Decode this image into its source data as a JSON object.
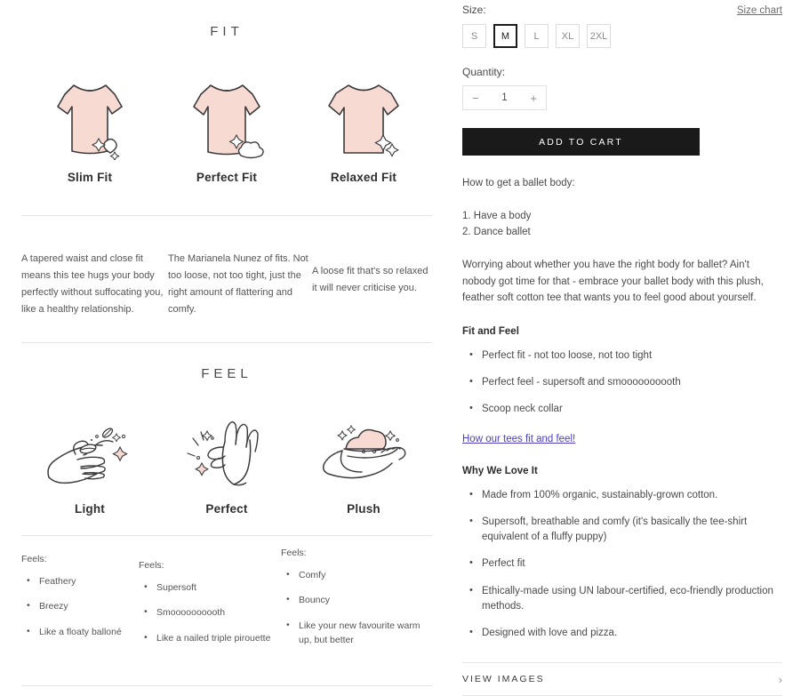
{
  "left": {
    "fit": {
      "heading": "FIT",
      "items": [
        {
          "label": "Slim Fit",
          "icon": "tshirt-slim-icon",
          "description": "A tapered waist and close fit means this tee hugs your body perfectly without suffocating you, like a healthy\nrelationship."
        },
        {
          "label": "Perfect Fit",
          "icon": "tshirt-perfect-icon",
          "description": "The Marianela Nunez of fits.\nNot too loose, not too tight, just the right amount of flattering and comfy."
        },
        {
          "label": "Relaxed Fit",
          "icon": "tshirt-relaxed-icon",
          "description": "A loose fit that's so relaxed it will never criticise you."
        }
      ]
    },
    "feel": {
      "heading": "FEEL",
      "items": [
        {
          "label": "Light",
          "icon": "hand-feather-icon",
          "feels_title": "Feels:",
          "feels": [
            "Feathery",
            "Breezy",
            "Like a floaty balloné"
          ]
        },
        {
          "label": "Perfect",
          "icon": "hand-snap-icon",
          "feels_title": "Feels:",
          "feels": [
            "Supersoft",
            "Smoooooooooth",
            "Like a nailed triple pirouette"
          ]
        },
        {
          "label": "Plush",
          "icon": "hand-cloud-icon",
          "feels_title": "Feels:",
          "feels": [
            "Comfy",
            "Bouncy",
            "Like your new favourite warm up, but better"
          ]
        }
      ]
    }
  },
  "right": {
    "size": {
      "label": "Size:",
      "chart_link": "Size chart",
      "options": [
        "S",
        "M",
        "L",
        "XL",
        "2XL"
      ],
      "selected": "M"
    },
    "quantity": {
      "label": "Quantity:",
      "value": "1",
      "decrement": "−",
      "increment": "+"
    },
    "add_to_cart": "ADD TO CART",
    "description": {
      "intro": "How to get a ballet body:",
      "steps": [
        "1. Have a body",
        "2. Dance ballet"
      ],
      "body": "Worrying about whether you have the right body for ballet? Ain't nobody got time for that - embrace your ballet body with this plush, feather soft cotton tee that wants you to feel good about yourself."
    },
    "fit_and_feel": {
      "heading": "Fit and Feel",
      "bullets": [
        "Perfect fit - not too loose, not too tight",
        "Perfect feel - supersoft and smoooooooooth",
        "Scoop neck collar"
      ],
      "link": "How our tees fit and feel!"
    },
    "why_we_love_it": {
      "heading": "Why We Love It",
      "bullets": [
        "Made from 100% organic, sustainably-grown cotton.",
        "Supersoft, breathable and comfy (it's basically the tee-shirt equivalent of a fluffy puppy)",
        "Perfect fit",
        "Ethically-made using UN labour-certified, eco-friendly production methods.",
        "Designed with love and pizza."
      ]
    },
    "view_images": {
      "label": "VIEW IMAGES",
      "chevron": "›"
    }
  },
  "colors": {
    "tshirt_fill": "#f7dbd2",
    "outline": "#3c3a3c",
    "accent_dark": "#1a1a1a",
    "link_purple": "#4b3fbe"
  }
}
